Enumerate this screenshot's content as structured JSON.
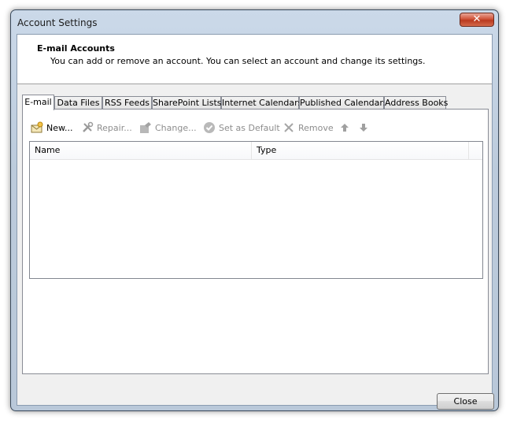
{
  "window": {
    "title": "Account Settings",
    "close_glyph": "✕"
  },
  "header": {
    "title": "E-mail Accounts",
    "description": "You can add or remove an account. You can select an account and change its settings."
  },
  "tabs": [
    {
      "label": "E-mail",
      "active": true
    },
    {
      "label": "Data Files"
    },
    {
      "label": "RSS Feeds"
    },
    {
      "label": "SharePoint Lists"
    },
    {
      "label": "Internet Calendars"
    },
    {
      "label": "Published Calendars"
    },
    {
      "label": "Address Books"
    }
  ],
  "toolbar": {
    "new_label": "New...",
    "repair_label": "Repair...",
    "change_label": "Change...",
    "set_default_label": "Set as Default",
    "remove_label": "Remove",
    "icons": [
      "new-account-icon",
      "repair-icon",
      "change-icon",
      "checkmark-icon",
      "remove-x-icon",
      "arrow-up-icon",
      "arrow-down-icon"
    ]
  },
  "list": {
    "columns": [
      "Name",
      "Type"
    ],
    "rows": []
  },
  "footer": {
    "close_label": "Close"
  },
  "colors": {
    "accent_title_bar": "#bccbdc",
    "close_red": "#c94a2e",
    "disabled_text": "#8d8d8d"
  }
}
